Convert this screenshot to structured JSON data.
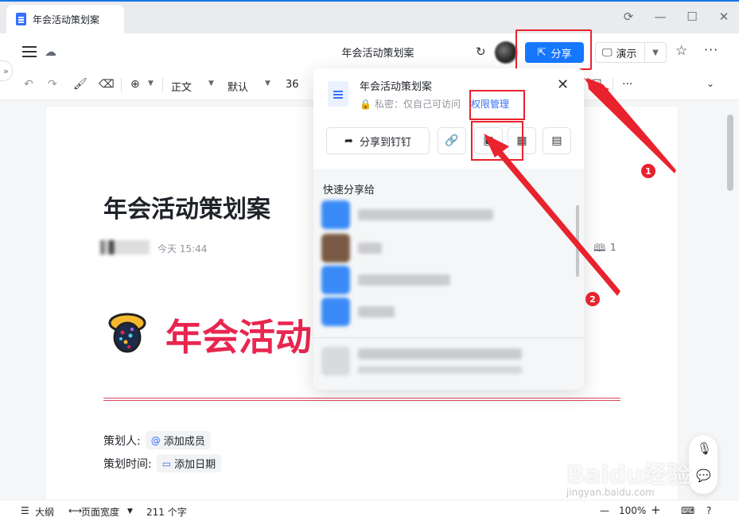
{
  "window": {
    "tab_title": "年会活动策划案"
  },
  "header": {
    "doc_title": "年会活动策划案",
    "share_label": "分享",
    "present_label": "演示"
  },
  "toolbar": {
    "style_label": "正文",
    "font_label": "默认",
    "size_label": "36"
  },
  "document": {
    "title": "年会活动策划案",
    "time": "今天 15:44",
    "read_count": "1",
    "banner_text": "年会活动",
    "fields": [
      {
        "label": "策划人:",
        "chip": "添加成员"
      },
      {
        "label": "策划时间:",
        "chip": "添加日期"
      }
    ]
  },
  "share_popup": {
    "title": "年会活动策划案",
    "privacy": "私密：仅自己可访问",
    "permission_link": "权限管理",
    "share_to_ding": "分享到钉钉",
    "quick_share_title": "快速分享给"
  },
  "statusbar": {
    "outline": "大纲",
    "page_width": "页面宽度",
    "word_count": "211 个字",
    "zoom": "100%"
  },
  "annotations": {
    "badge1": "1",
    "badge2": "2"
  },
  "watermark": {
    "main": "Baidu经验",
    "sub": "jingyan.baidu.com"
  },
  "colors": {
    "accent": "#1677ff",
    "annotation_red": "#e8232e",
    "banner_red": "#e8264f"
  }
}
